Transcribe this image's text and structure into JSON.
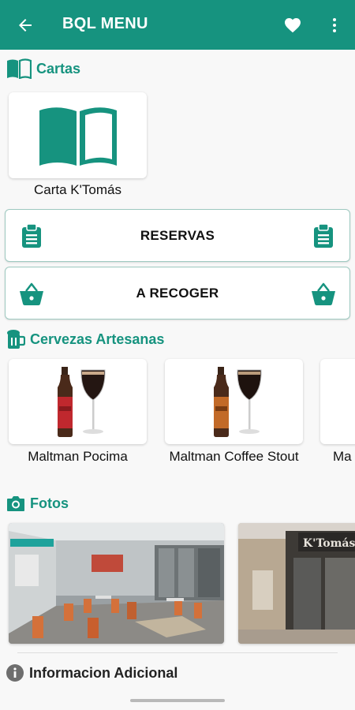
{
  "app_bar": {
    "title": "BQL MENU",
    "color": "#16937f",
    "back_icon": "arrow-left-icon",
    "favorite_icon": "heart-icon",
    "more_icon": "more-vertical-icon"
  },
  "cartas": {
    "heading": "Cartas",
    "icon": "open-book-icon",
    "items": [
      {
        "label": "Carta K'Tomás",
        "icon": "open-book-icon"
      }
    ]
  },
  "actions": [
    {
      "label": "RESERVAS",
      "icon": "clipboard-icon"
    },
    {
      "label": "A RECOGER",
      "icon": "shopping-basket-icon"
    }
  ],
  "cervezas": {
    "heading": "Cervezas Artesanas",
    "icon": "beer-mug-icon",
    "items": [
      {
        "name": "Maltman Pocima",
        "bottle_label_color": "#c0282e"
      },
      {
        "name": "Maltman Coffee Stout",
        "bottle_label_color": "#c26a28"
      },
      {
        "name": "Ma"
      }
    ]
  },
  "fotos": {
    "heading": "Fotos",
    "icon": "camera-icon",
    "items": [
      {
        "alt": "restaurant interior photo"
      },
      {
        "alt": "restaurant facade photo",
        "sign_text": "K'Tomás"
      }
    ]
  },
  "info": {
    "heading": "Informacion Adicional",
    "icon": "info-circle-icon"
  }
}
